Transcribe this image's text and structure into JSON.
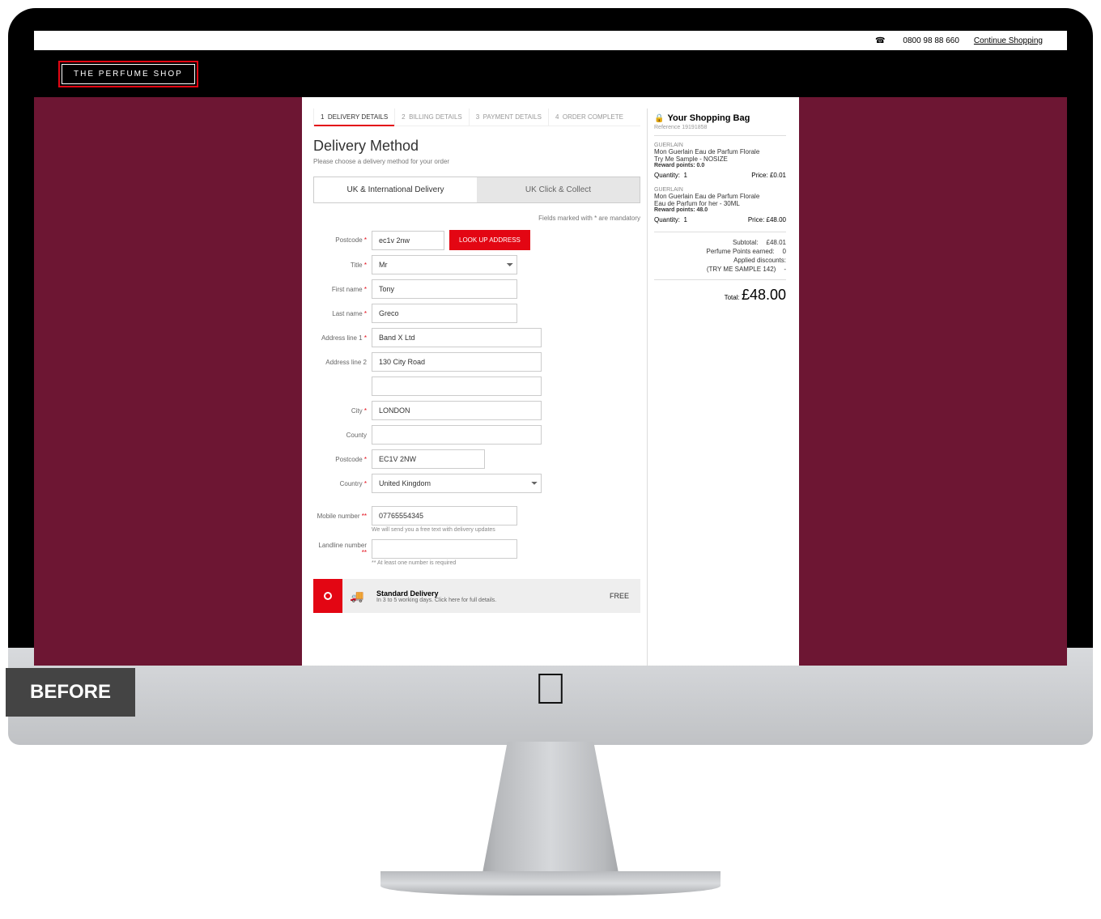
{
  "topbar": {
    "phone": "0800 98 88 660",
    "continue": "Continue Shopping"
  },
  "logo": "THE PERFUME SHOP",
  "steps": [
    {
      "n": "1",
      "label": "DELIVERY DETAILS",
      "active": true
    },
    {
      "n": "2",
      "label": "BILLING DETAILS",
      "active": false
    },
    {
      "n": "3",
      "label": "PAYMENT DETAILS",
      "active": false
    },
    {
      "n": "4",
      "label": "ORDER COMPLETE",
      "active": false
    }
  ],
  "heading": "Delivery Method",
  "subtitle": "Please choose a delivery method for your order",
  "tabs": {
    "tab1": "UK & International Delivery",
    "tab2": "UK Click & Collect"
  },
  "mandatory_note": "Fields marked with * are mandatory",
  "form": {
    "postcode_label": "Postcode",
    "postcode_lookup_value": "ec1v 2nw",
    "lookup_btn": "LOOK UP ADDRESS",
    "title_label": "Title",
    "title_value": "Mr",
    "firstname_label": "First name",
    "firstname_value": "Tony",
    "lastname_label": "Last name",
    "lastname_value": "Greco",
    "addr1_label": "Address line 1",
    "addr1_value": "Band X Ltd",
    "addr2_label": "Address line 2",
    "addr2_value": "130 City Road",
    "addr3_value": "",
    "city_label": "City",
    "city_value": "LONDON",
    "county_label": "County",
    "county_value": "",
    "postcode2_label": "Postcode",
    "postcode2_value": "EC1V 2NW",
    "country_label": "Country",
    "country_value": "United Kingdom",
    "mobile_label": "Mobile number",
    "mobile_value": "07765554345",
    "mobile_helper": "We will send you a free text with delivery updates",
    "landline_label": "Landline number",
    "landline_value": "",
    "landline_helper": "** At least one number is required"
  },
  "delivery_option": {
    "title": "Standard Delivery",
    "desc": "In 3 to 5 working days. Click here for full details.",
    "price": "FREE"
  },
  "bag": {
    "title": "Your Shopping Bag",
    "reference": "Reference 19191858",
    "items": [
      {
        "brand": "GUERLAIN",
        "name": "Mon Guerlain Eau de Parfum Florale",
        "variant": "Try Me Sample - NOSIZE",
        "points": "Reward points: 0.0",
        "qty_label": "Quantity:",
        "qty": "1",
        "price_label": "Price:",
        "price": "£0.01"
      },
      {
        "brand": "GUERLAIN",
        "name": "Mon Guerlain Eau de Parfum Florale",
        "variant": "Eau de Parfum for her - 30ML",
        "points": "Reward points: 48.0",
        "qty_label": "Quantity:",
        "qty": "1",
        "price_label": "Price:",
        "price": "£48.00"
      }
    ],
    "subtotal_label": "Subtotal:",
    "subtotal": "£48.01",
    "points_label": "Perfume Points earned:",
    "points": "0",
    "discounts_label": "Applied discounts:",
    "discount_name": "(TRY ME SAMPLE 142)",
    "discount_val": "-",
    "total_label": "Total:",
    "total": "£48.00"
  },
  "before_label": "BEFORE"
}
